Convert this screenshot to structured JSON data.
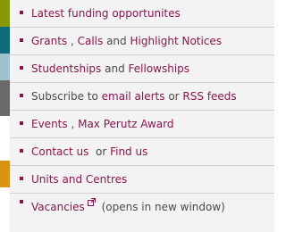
{
  "colors": {
    "link": "#8a1550",
    "text": "#4a4a4a",
    "menu_bg": "#f3f3f3",
    "divider": "#d2d2d2",
    "strip": [
      "#88980a",
      "#0e6a7a",
      "#9fc2cc",
      "#6a6a6a",
      "#d89312",
      "#ffffff"
    ]
  },
  "menu": {
    "item1": {
      "link": "Latest funding opportunites"
    },
    "item2": {
      "link1": "Grants",
      "sep1": " , ",
      "link2": "Calls",
      "sep2": " and ",
      "link3": "Highlight Notices"
    },
    "item3": {
      "link1": "Studentships",
      "sep1": " and ",
      "link2": "Fellowships"
    },
    "item4": {
      "text1": "Subscribe to ",
      "link1": "email alerts",
      "sep1": " or ",
      "link2": "RSS feeds"
    },
    "item5": {
      "link1": "Events",
      "sep1": " , ",
      "link2": "Max Perutz Award"
    },
    "item6": {
      "link1": "Contact us",
      "sep1": "  or ",
      "link2": "Find us"
    },
    "item7": {
      "link": "Units and Centres"
    },
    "item8": {
      "link": "Vacancies",
      "icon": "external-link-icon",
      "note": " (opens in new window)"
    }
  }
}
